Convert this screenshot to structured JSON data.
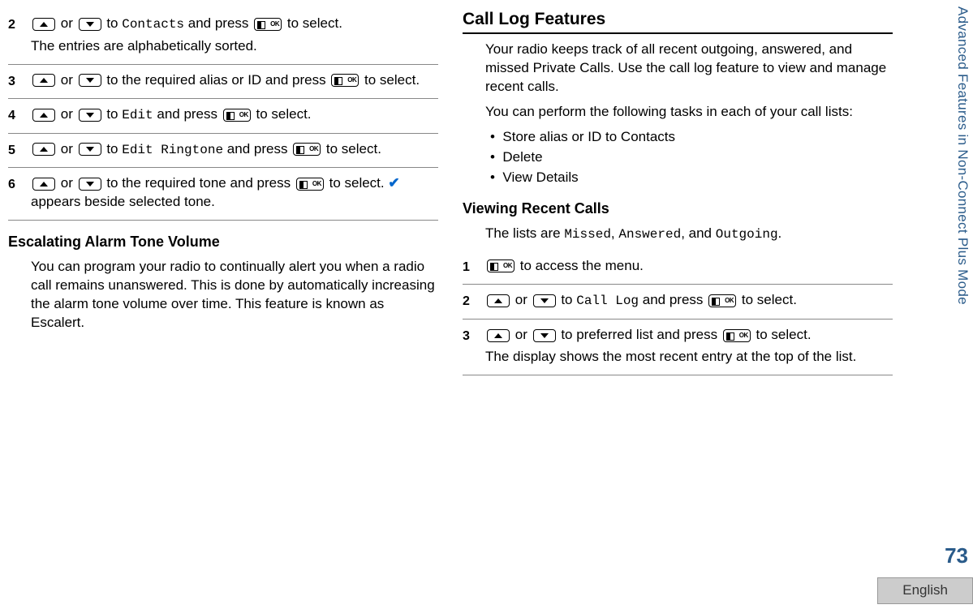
{
  "side_tab": "Advanced Features in Non-Connect Plus Mode",
  "page_number": "73",
  "language": "English",
  "left": {
    "steps": [
      {
        "num": "2",
        "pre": " or ",
        "target": "Contacts",
        "mid": " and press ",
        "post": " to select.",
        "extra": "The entries are alphabetically sorted."
      },
      {
        "num": "3",
        "pre": " or ",
        "plain_target": " to the required alias or ID and press ",
        "post": " to select."
      },
      {
        "num": "4",
        "pre": " or ",
        "target": "Edit",
        "mid": " and press ",
        "post": " to select."
      },
      {
        "num": "5",
        "pre": " or ",
        "target": "Edit Ringtone",
        "mid": " and press ",
        "post": " to select."
      },
      {
        "num": "6",
        "pre": " or ",
        "plain_target": " to the required tone and press ",
        "post": " to select. ",
        "extra_inline": " appears beside selected tone."
      }
    ],
    "sub_heading": "Escalating Alarm Tone Volume",
    "sub_para": "You can program your radio to continually alert you when a radio call remains unanswered. This is done by automatically increasing the alarm tone volume over time. This feature is known as Escalert."
  },
  "right": {
    "main_heading": "Call Log Features",
    "para1": "Your radio keeps track of all recent outgoing, answered, and missed Private Calls. Use the call log feature to view and manage recent calls.",
    "para2": "You can perform the following tasks in each of your call lists:",
    "bullets": [
      "Store alias or ID to Contacts",
      "Delete",
      "View Details"
    ],
    "sub_heading": "Viewing Recent Calls",
    "lists_line_pre": "The lists are ",
    "lists": [
      "Missed",
      "Answered",
      "Outgoing"
    ],
    "steps": [
      {
        "num": "1",
        "post": " to access the menu."
      },
      {
        "num": "2",
        "pre": " or ",
        "target": "Call Log",
        "mid": " and press ",
        "post": " to select."
      },
      {
        "num": "3",
        "pre": " or ",
        "plain_target": " to preferred list and press ",
        "post": " to select.",
        "extra": "The display shows the most recent entry at the top of the list."
      }
    ]
  }
}
